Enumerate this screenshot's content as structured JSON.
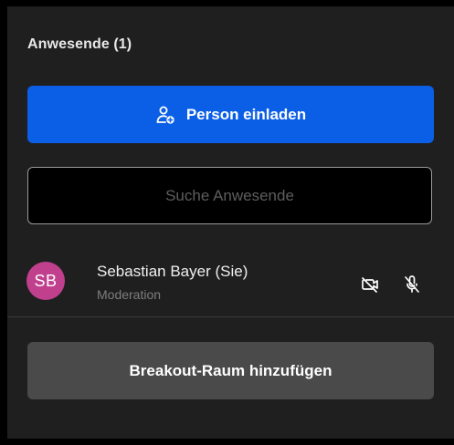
{
  "panel": {
    "title": "Anwesende (1)"
  },
  "invite_button": {
    "label": "Person einladen",
    "icon": "user-plus-icon",
    "color": "#0b5fe6"
  },
  "search": {
    "placeholder": "Suche Anwesende",
    "value": ""
  },
  "participants": [
    {
      "initials": "SB",
      "name": "Sebastian Bayer (Sie)",
      "role": "Moderation",
      "avatar_color": "#c0408e",
      "camera": "camera-off-icon",
      "microphone": "microphone-off-icon"
    }
  ],
  "breakout_button": {
    "label": "Breakout-Raum hinzufügen"
  }
}
